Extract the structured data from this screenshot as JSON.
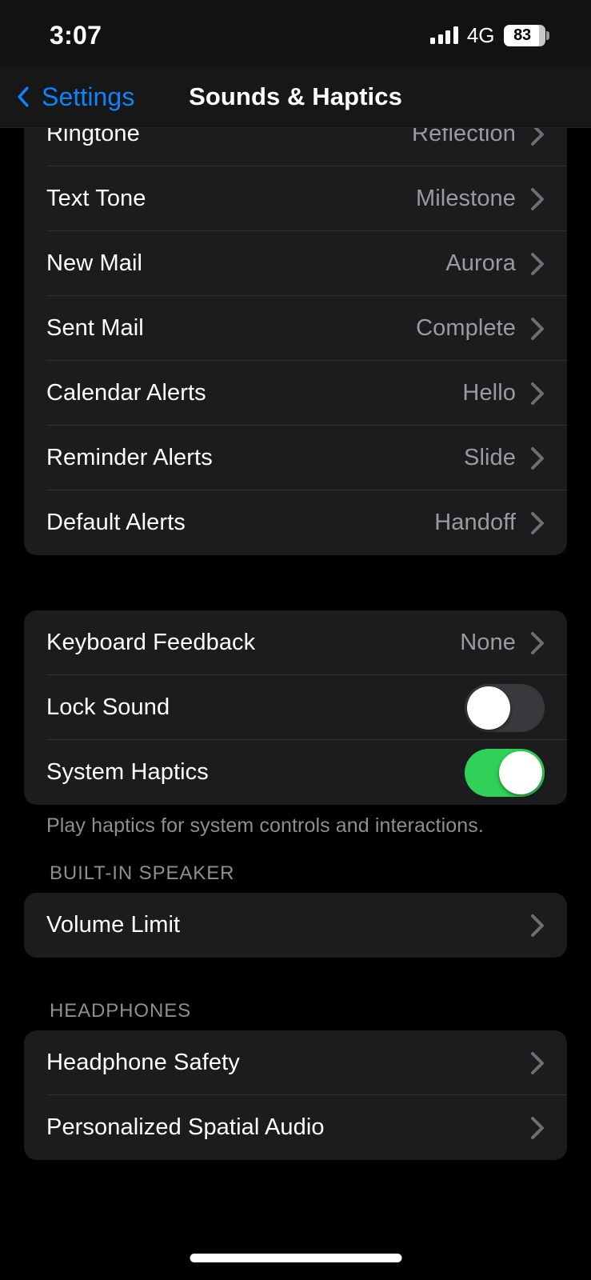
{
  "status_bar": {
    "time": "3:07",
    "network": "4G",
    "battery_percent": "83",
    "signal_icon": "cellular-bars-icon",
    "battery_icon": "battery-icon"
  },
  "nav": {
    "back_label": "Settings",
    "back_icon": "chevron-left-icon",
    "title": "Sounds & Haptics"
  },
  "colors": {
    "accent_blue": "#0A84FF",
    "toggle_on_green": "#30D158",
    "toggle_off_gray": "#39393D",
    "card_bg": "#1C1C1E",
    "page_bg": "#000000",
    "separator": "#303032",
    "secondary_text": "#8E8E93"
  },
  "sections": [
    {
      "name": "sounds-and-vibration-patterns",
      "header": "",
      "footer": "",
      "rows": [
        {
          "label": "Ringtone",
          "value": "Reflection",
          "type": "disclosure",
          "clipped": true
        },
        {
          "label": "Text Tone",
          "value": "Milestone",
          "type": "disclosure"
        },
        {
          "label": "New Mail",
          "value": "Aurora",
          "type": "disclosure"
        },
        {
          "label": "Sent Mail",
          "value": "Complete",
          "type": "disclosure"
        },
        {
          "label": "Calendar Alerts",
          "value": "Hello",
          "type": "disclosure"
        },
        {
          "label": "Reminder Alerts",
          "value": "Slide",
          "type": "disclosure"
        },
        {
          "label": "Default Alerts",
          "value": "Handoff",
          "type": "disclosure"
        }
      ]
    },
    {
      "name": "feedback",
      "header": "",
      "footer": "Play haptics for system controls and interactions.",
      "rows": [
        {
          "label": "Keyboard Feedback",
          "value": "None",
          "type": "disclosure"
        },
        {
          "label": "Lock Sound",
          "value": "",
          "type": "toggle",
          "toggle_on": false
        },
        {
          "label": "System Haptics",
          "value": "",
          "type": "toggle",
          "toggle_on": true
        }
      ]
    },
    {
      "name": "built-in-speaker",
      "header": "BUILT-IN SPEAKER",
      "footer": "",
      "rows": [
        {
          "label": "Volume Limit",
          "value": "",
          "type": "disclosure"
        }
      ]
    },
    {
      "name": "headphones",
      "header": "HEADPHONES",
      "footer": "",
      "rows": [
        {
          "label": "Headphone Safety",
          "value": "",
          "type": "disclosure"
        },
        {
          "label": "Personalized Spatial Audio",
          "value": "",
          "type": "disclosure"
        }
      ]
    }
  ],
  "home_indicator": "home-indicator"
}
